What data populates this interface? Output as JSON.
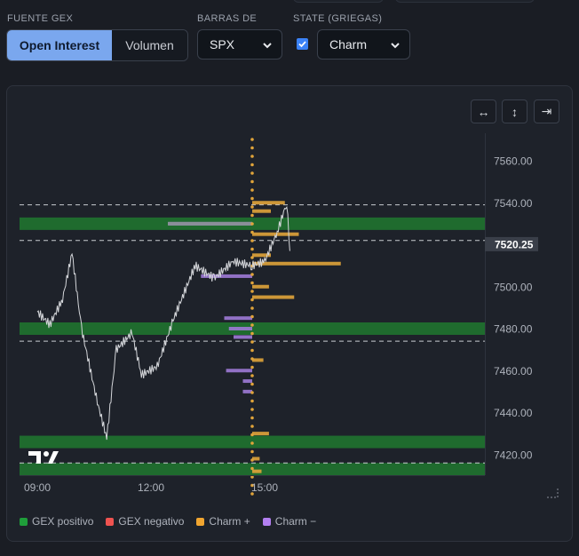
{
  "controls": {
    "gex_source_label": "FUENTE GEX",
    "gex_options": [
      "Open Interest",
      "Volumen"
    ],
    "gex_selected": "Open Interest",
    "bars_label": "BARRAS DE",
    "bars_value": "SPX",
    "state_label": "STATE (GRIEGAS)",
    "state_checked": true,
    "greek_value": "Charm"
  },
  "toolbar": {
    "fit_horizontal": "↔",
    "fit_vertical": "↕",
    "scroll_to_end": "⇥"
  },
  "chart": {
    "price_axis": [
      "7560.00",
      "7540.00",
      "7520.25",
      "7500.00",
      "7480.00",
      "7460.00",
      "7440.00",
      "7420.00"
    ],
    "current_price": "7520.25",
    "time_axis": [
      "09:00",
      "12:00",
      "15:00"
    ]
  },
  "chart_data": {
    "type": "line",
    "y_range": [
      7408,
      7570
    ],
    "gex_positive_levels": [
      7480,
      7426,
      7530,
      7413
    ],
    "dashed_levels": [
      7539,
      7522,
      7474,
      7416
    ],
    "price_path": [
      {
        "t": "09:00",
        "v": 7488
      },
      {
        "t": "09:20",
        "v": 7482
      },
      {
        "t": "09:40",
        "v": 7494
      },
      {
        "t": "09:55",
        "v": 7516
      },
      {
        "t": "10:10",
        "v": 7480
      },
      {
        "t": "10:35",
        "v": 7445
      },
      {
        "t": "10:50",
        "v": 7428
      },
      {
        "t": "11:05",
        "v": 7470
      },
      {
        "t": "11:30",
        "v": 7478
      },
      {
        "t": "11:45",
        "v": 7458
      },
      {
        "t": "12:10",
        "v": 7462
      },
      {
        "t": "12:35",
        "v": 7484
      },
      {
        "t": "13:10",
        "v": 7510
      },
      {
        "t": "13:40",
        "v": 7504
      },
      {
        "t": "14:10",
        "v": 7512
      },
      {
        "t": "14:40",
        "v": 7510
      },
      {
        "t": "15:00",
        "v": 7512
      },
      {
        "t": "15:20",
        "v": 7526
      },
      {
        "t": "15:35",
        "v": 7540
      },
      {
        "t": "15:40",
        "v": 7517
      }
    ],
    "charm_bars": [
      {
        "price": 7540,
        "sign": "+",
        "size": 0.35
      },
      {
        "price": 7536,
        "sign": "+",
        "size": 0.2
      },
      {
        "price": 7530,
        "sign": "-",
        "size": 0.9
      },
      {
        "price": 7525,
        "sign": "+",
        "size": 0.5
      },
      {
        "price": 7515,
        "sign": "+",
        "size": 0.2
      },
      {
        "price": 7511,
        "sign": "+",
        "size": 0.95
      },
      {
        "price": 7505,
        "sign": "-",
        "size": 0.55
      },
      {
        "price": 7500,
        "sign": "+",
        "size": 0.18
      },
      {
        "price": 7495,
        "sign": "+",
        "size": 0.45
      },
      {
        "price": 7485,
        "sign": "-",
        "size": 0.3
      },
      {
        "price": 7480,
        "sign": "-",
        "size": 0.25
      },
      {
        "price": 7476,
        "sign": "-",
        "size": 0.2
      },
      {
        "price": 7465,
        "sign": "+",
        "size": 0.12
      },
      {
        "price": 7460,
        "sign": "-",
        "size": 0.28
      },
      {
        "price": 7455,
        "sign": "-",
        "size": 0.1
      },
      {
        "price": 7450,
        "sign": "-",
        "size": 0.1
      },
      {
        "price": 7430,
        "sign": "+",
        "size": 0.18
      },
      {
        "price": 7418,
        "sign": "+",
        "size": 0.08
      },
      {
        "price": 7412,
        "sign": "+",
        "size": 0.1
      }
    ]
  },
  "legend": {
    "gex_positive": "GEX positivo",
    "gex_negative": "GEX negativo",
    "charm_plus": "Charm +",
    "charm_minus": "Charm −"
  },
  "colors": {
    "gex_positive": "#1f6b2e",
    "gex_negative": "#ef5350",
    "charm_plus": "#e0a43a",
    "charm_minus": "#9d7ad6",
    "accent": "#7aa7ee"
  }
}
